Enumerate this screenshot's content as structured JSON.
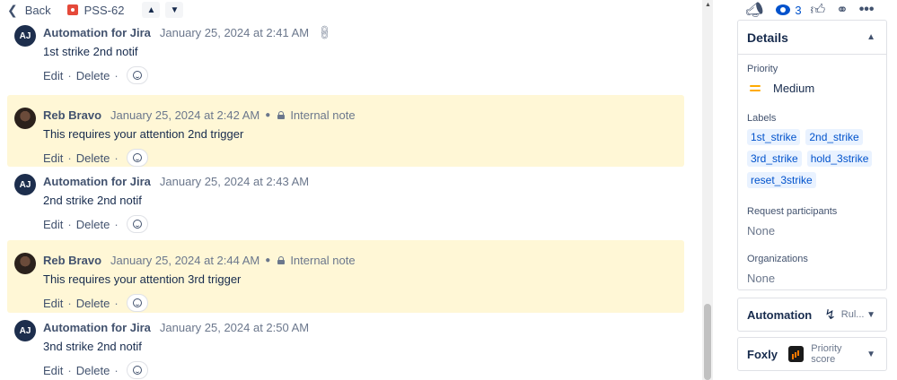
{
  "topbar": {
    "back_label": "Back",
    "issue_key": "PSS-62",
    "prev_icon": "chevron-up-icon",
    "next_icon": "chevron-down-icon"
  },
  "comments": [
    {
      "author": "Automation for Jira",
      "avatar": "AJ",
      "date": "January 25, 2024 at 2:41 AM",
      "text": "1st strike 2nd notif",
      "internal": false,
      "internal_label": ""
    },
    {
      "author": "Reb Bravo",
      "avatar": "",
      "date": "January 25, 2024 at 2:42 AM",
      "text": "This requires your attention 2nd trigger",
      "internal": true,
      "internal_label": "Internal note"
    },
    {
      "author": "Automation for Jira",
      "avatar": "AJ",
      "date": "January 25, 2024 at 2:43 AM",
      "text": "2nd strike 2nd notif",
      "internal": false,
      "internal_label": ""
    },
    {
      "author": "Reb Bravo",
      "avatar": "",
      "date": "January 25, 2024 at 2:44 AM",
      "text": "This requires your attention 3rd trigger",
      "internal": true,
      "internal_label": "Internal note"
    },
    {
      "author": "Automation for Jira",
      "avatar": "AJ",
      "date": "January 25, 2024 at 2:50 AM",
      "text": "3nd strike 2nd notif",
      "internal": false,
      "internal_label": ""
    }
  ],
  "comment_actions": {
    "edit": "Edit",
    "delete": "Delete",
    "sep": "·"
  },
  "toolbar": {
    "watch_count": "3"
  },
  "details": {
    "title": "Details",
    "priority_label": "Priority",
    "priority_value": "Medium",
    "priority_color": "#ffab00",
    "labels_label": "Labels",
    "labels": [
      "1st_strike",
      "2nd_strike",
      "3rd_strike",
      "hold_3strike",
      "reset_3strike"
    ],
    "participants_label": "Request participants",
    "participants_value": "None",
    "organizations_label": "Organizations",
    "organizations_value": "None"
  },
  "automation": {
    "title": "Automation",
    "sub": "Rul..."
  },
  "foxly": {
    "title": "Foxly",
    "sub": "Priority score"
  }
}
